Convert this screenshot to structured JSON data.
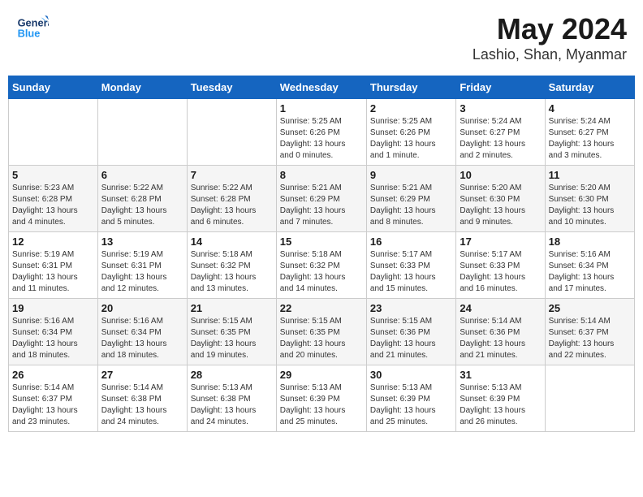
{
  "header": {
    "logo_line1": "General",
    "logo_line2": "Blue",
    "title": "May 2024",
    "subtitle": "Lashio, Shan, Myanmar"
  },
  "weekdays": [
    "Sunday",
    "Monday",
    "Tuesday",
    "Wednesday",
    "Thursday",
    "Friday",
    "Saturday"
  ],
  "weeks": [
    [
      {
        "day": "",
        "info": ""
      },
      {
        "day": "",
        "info": ""
      },
      {
        "day": "",
        "info": ""
      },
      {
        "day": "1",
        "info": "Sunrise: 5:25 AM\nSunset: 6:26 PM\nDaylight: 13 hours\nand 0 minutes."
      },
      {
        "day": "2",
        "info": "Sunrise: 5:25 AM\nSunset: 6:26 PM\nDaylight: 13 hours\nand 1 minute."
      },
      {
        "day": "3",
        "info": "Sunrise: 5:24 AM\nSunset: 6:27 PM\nDaylight: 13 hours\nand 2 minutes."
      },
      {
        "day": "4",
        "info": "Sunrise: 5:24 AM\nSunset: 6:27 PM\nDaylight: 13 hours\nand 3 minutes."
      }
    ],
    [
      {
        "day": "5",
        "info": "Sunrise: 5:23 AM\nSunset: 6:28 PM\nDaylight: 13 hours\nand 4 minutes."
      },
      {
        "day": "6",
        "info": "Sunrise: 5:22 AM\nSunset: 6:28 PM\nDaylight: 13 hours\nand 5 minutes."
      },
      {
        "day": "7",
        "info": "Sunrise: 5:22 AM\nSunset: 6:28 PM\nDaylight: 13 hours\nand 6 minutes."
      },
      {
        "day": "8",
        "info": "Sunrise: 5:21 AM\nSunset: 6:29 PM\nDaylight: 13 hours\nand 7 minutes."
      },
      {
        "day": "9",
        "info": "Sunrise: 5:21 AM\nSunset: 6:29 PM\nDaylight: 13 hours\nand 8 minutes."
      },
      {
        "day": "10",
        "info": "Sunrise: 5:20 AM\nSunset: 6:30 PM\nDaylight: 13 hours\nand 9 minutes."
      },
      {
        "day": "11",
        "info": "Sunrise: 5:20 AM\nSunset: 6:30 PM\nDaylight: 13 hours\nand 10 minutes."
      }
    ],
    [
      {
        "day": "12",
        "info": "Sunrise: 5:19 AM\nSunset: 6:31 PM\nDaylight: 13 hours\nand 11 minutes."
      },
      {
        "day": "13",
        "info": "Sunrise: 5:19 AM\nSunset: 6:31 PM\nDaylight: 13 hours\nand 12 minutes."
      },
      {
        "day": "14",
        "info": "Sunrise: 5:18 AM\nSunset: 6:32 PM\nDaylight: 13 hours\nand 13 minutes."
      },
      {
        "day": "15",
        "info": "Sunrise: 5:18 AM\nSunset: 6:32 PM\nDaylight: 13 hours\nand 14 minutes."
      },
      {
        "day": "16",
        "info": "Sunrise: 5:17 AM\nSunset: 6:33 PM\nDaylight: 13 hours\nand 15 minutes."
      },
      {
        "day": "17",
        "info": "Sunrise: 5:17 AM\nSunset: 6:33 PM\nDaylight: 13 hours\nand 16 minutes."
      },
      {
        "day": "18",
        "info": "Sunrise: 5:16 AM\nSunset: 6:34 PM\nDaylight: 13 hours\nand 17 minutes."
      }
    ],
    [
      {
        "day": "19",
        "info": "Sunrise: 5:16 AM\nSunset: 6:34 PM\nDaylight: 13 hours\nand 18 minutes."
      },
      {
        "day": "20",
        "info": "Sunrise: 5:16 AM\nSunset: 6:34 PM\nDaylight: 13 hours\nand 18 minutes."
      },
      {
        "day": "21",
        "info": "Sunrise: 5:15 AM\nSunset: 6:35 PM\nDaylight: 13 hours\nand 19 minutes."
      },
      {
        "day": "22",
        "info": "Sunrise: 5:15 AM\nSunset: 6:35 PM\nDaylight: 13 hours\nand 20 minutes."
      },
      {
        "day": "23",
        "info": "Sunrise: 5:15 AM\nSunset: 6:36 PM\nDaylight: 13 hours\nand 21 minutes."
      },
      {
        "day": "24",
        "info": "Sunrise: 5:14 AM\nSunset: 6:36 PM\nDaylight: 13 hours\nand 21 minutes."
      },
      {
        "day": "25",
        "info": "Sunrise: 5:14 AM\nSunset: 6:37 PM\nDaylight: 13 hours\nand 22 minutes."
      }
    ],
    [
      {
        "day": "26",
        "info": "Sunrise: 5:14 AM\nSunset: 6:37 PM\nDaylight: 13 hours\nand 23 minutes."
      },
      {
        "day": "27",
        "info": "Sunrise: 5:14 AM\nSunset: 6:38 PM\nDaylight: 13 hours\nand 24 minutes."
      },
      {
        "day": "28",
        "info": "Sunrise: 5:13 AM\nSunset: 6:38 PM\nDaylight: 13 hours\nand 24 minutes."
      },
      {
        "day": "29",
        "info": "Sunrise: 5:13 AM\nSunset: 6:39 PM\nDaylight: 13 hours\nand 25 minutes."
      },
      {
        "day": "30",
        "info": "Sunrise: 5:13 AM\nSunset: 6:39 PM\nDaylight: 13 hours\nand 25 minutes."
      },
      {
        "day": "31",
        "info": "Sunrise: 5:13 AM\nSunset: 6:39 PM\nDaylight: 13 hours\nand 26 minutes."
      },
      {
        "day": "",
        "info": ""
      }
    ]
  ]
}
